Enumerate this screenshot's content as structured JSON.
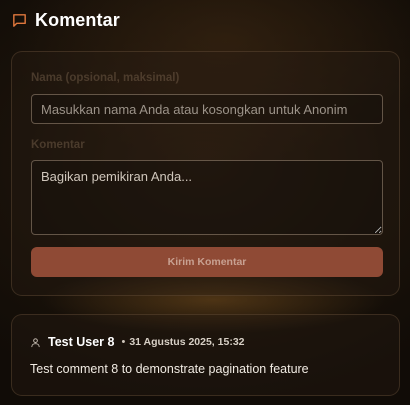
{
  "header": {
    "title": "Komentar",
    "icon": "comment-icon",
    "icon_color": "#e0773c"
  },
  "form": {
    "name_label": "Nama (opsional, maksimal)",
    "name_placeholder": "Masukkan nama Anda atau kosongkan untuk Anonim",
    "name_value": "",
    "comment_label": "Komentar",
    "comment_placeholder": "Bagikan pemikiran Anda...",
    "comment_value": "",
    "submit_label": "Kirim Komentar",
    "submit_color": "#8f4a35"
  },
  "comments": [
    {
      "icon": "user-icon",
      "author": "Test User 8",
      "separator": "•",
      "time": "31 Agustus 2025, 15:32",
      "text": "Test comment 8 to demonstrate pagination feature"
    }
  ]
}
